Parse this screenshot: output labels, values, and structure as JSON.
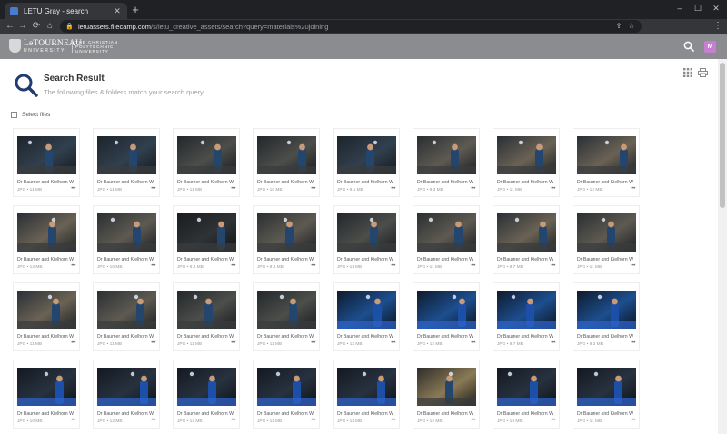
{
  "browser": {
    "tab_title": "LETU Gray - search",
    "new_tab": "+",
    "tab_close": "✕",
    "url_host": "letuassets.filecamp.com",
    "url_path": "/s/letu_creative_assets/search?query=materials%20joining",
    "win_minimize": "–",
    "win_maximize": "☐",
    "win_close": "✕",
    "back": "←",
    "forward": "→",
    "reload": "⟳",
    "home": "⌂",
    "menu": "⋮",
    "lock_icon": "🔒",
    "share_icon": "⇪",
    "star_icon": "☆"
  },
  "header": {
    "logo_name": "LeTOURNEAU",
    "logo_sub": "UNIVERSITY",
    "logo_tag": "THE CHRISTIAN POLYTECHNIC UNIVERSITY",
    "avatar_letter": "M",
    "brand_color": "#8a8c8f"
  },
  "search": {
    "title": "Search Result",
    "subtitle": "The following files & folders match your search query.",
    "select_label": "Select files"
  },
  "files": [
    {
      "caption": "Dr Baumer and Kielhorn Weld...",
      "meta": "JPG • 11 MB",
      "scene": "a"
    },
    {
      "caption": "Dr Baumer and Kielhorn Weld...",
      "meta": "JPG • 11 MB",
      "scene": "a"
    },
    {
      "caption": "Dr Baumer and Kielhorn Weld...",
      "meta": "JPG • 11 MB",
      "scene": "b"
    },
    {
      "caption": "Dr Baumer and Kielhorn Weld...",
      "meta": "JPG • 10 MB",
      "scene": "b"
    },
    {
      "caption": "Dr Baumer and Kielhorn Weld...",
      "meta": "JPG • 9.5 MB",
      "scene": "a"
    },
    {
      "caption": "Dr Baumer and Kielhorn Weld...",
      "meta": "JPG • 9.3 MB",
      "scene": "c"
    },
    {
      "caption": "Dr Baumer and Kielhorn Weld...",
      "meta": "JPG • 11 MB",
      "scene": "d"
    },
    {
      "caption": "Dr Baumer and Kielhorn Weld...",
      "meta": "JPG • 12 MB",
      "scene": "d"
    },
    {
      "caption": "Dr Baumer and Kielhorn Weld...",
      "meta": "JPG • 12 MB",
      "scene": "d"
    },
    {
      "caption": "Dr Baumer and Kielhorn Weld...",
      "meta": "JPG • 10 MB",
      "scene": "c"
    },
    {
      "caption": "Dr Baumer and Kielhorn Weld...",
      "meta": "JPG • 6.4 MB",
      "scene": "e"
    },
    {
      "caption": "Dr Baumer and Kielhorn Weld...",
      "meta": "JPG • 9.4 MB",
      "scene": "c"
    },
    {
      "caption": "Dr Baumer and Kielhorn Weld...",
      "meta": "JPG • 11 MB",
      "scene": "b"
    },
    {
      "caption": "Dr Baumer and Kielhorn Weld...",
      "meta": "JPG • 11 MB",
      "scene": "c"
    },
    {
      "caption": "Dr Baumer and Kielhorn Weld...",
      "meta": "JPG • 9.7 MB",
      "scene": "d"
    },
    {
      "caption": "Dr Baumer and Kielhorn Weld...",
      "meta": "JPG • 11 MB",
      "scene": "c"
    },
    {
      "caption": "Dr Baumer and Kielhorn Weld...",
      "meta": "JPG • 11 MB",
      "scene": "d"
    },
    {
      "caption": "Dr Baumer and Kielhorn Weld...",
      "meta": "JPG • 11 MB",
      "scene": "c"
    },
    {
      "caption": "Dr Baumer and Kielhorn Weld...",
      "meta": "JPG • 11 MB",
      "scene": "b"
    },
    {
      "caption": "Dr Baumer and Kielhorn Weld...",
      "meta": "JPG • 11 MB",
      "scene": "b"
    },
    {
      "caption": "Dr Baumer and Kielhorn Weld...",
      "meta": "JPG • 12 MB",
      "scene": "f"
    },
    {
      "caption": "Dr Baumer and Kielhorn Weld...",
      "meta": "JPG • 12 MB",
      "scene": "f"
    },
    {
      "caption": "Dr Baumer and Kielhorn Weld...",
      "meta": "JPG • 9.7 MB",
      "scene": "f"
    },
    {
      "caption": "Dr Baumer and Kielhorn Weld...",
      "meta": "JPG • 9.3 MB",
      "scene": "f"
    },
    {
      "caption": "Dr Baumer and Kielhorn Weld...",
      "meta": "JPG • 10 MB",
      "scene": "g"
    },
    {
      "caption": "Dr Baumer and Kielhorn Weld...",
      "meta": "JPG • 12 MB",
      "scene": "g"
    },
    {
      "caption": "Dr Baumer and Kielhorn Weld...",
      "meta": "JPG • 12 MB",
      "scene": "g"
    },
    {
      "caption": "Dr Baumer and Kielhorn Weld...",
      "meta": "JPG • 11 MB",
      "scene": "g"
    },
    {
      "caption": "Dr Baumer and Kielhorn Weld...",
      "meta": "JPG • 11 MB",
      "scene": "g"
    },
    {
      "caption": "Dr Baumer and Kielhorn Weld...",
      "meta": "JPG • 12 MB",
      "scene": "h"
    },
    {
      "caption": "Dr Baumer and Kielhorn Weld...",
      "meta": "JPG • 13 MB",
      "scene": "g"
    },
    {
      "caption": "Dr Baumer and Kielhorn Weld...",
      "meta": "JPG • 11 MB",
      "scene": "g"
    }
  ]
}
